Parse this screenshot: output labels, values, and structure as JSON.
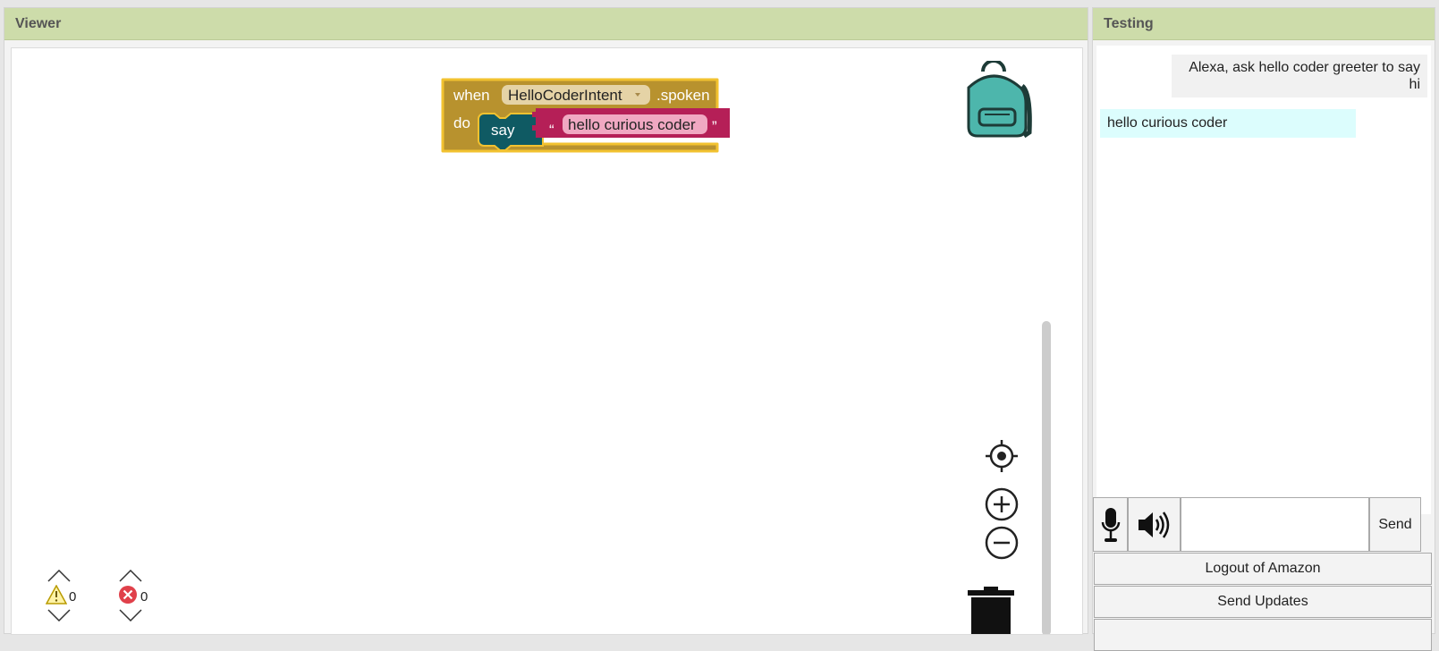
{
  "viewer": {
    "title": "Viewer",
    "block": {
      "when_label": "when",
      "intent_dropdown": "HelloCoderIntent",
      "spoken_label": ".spoken",
      "do_label": "do",
      "say_label": "say",
      "quote_open": "“",
      "string_value": "hello curious coder",
      "quote_close": "”"
    },
    "warnings": {
      "warning_count": "0",
      "error_count": "0"
    }
  },
  "testing": {
    "title": "Testing",
    "chat": {
      "user_message": "Alexa, ask hello coder greeter to say hi",
      "bot_message": "hello curious coder"
    },
    "controls": {
      "input_value": "",
      "send_label": "Send",
      "logout_label": "Logout of Amazon",
      "send_updates_label": "Send Updates"
    }
  },
  "colors": {
    "header_bg": "#cddcaa",
    "event_block": "#b8922e",
    "event_border": "#f2c230",
    "say_block": "#0f5a63",
    "text_block": "#b51f57",
    "text_field": "#f0a8c2",
    "bot_bubble": "#dcfdfd",
    "backpack": "#4db6ac"
  },
  "icons": [
    "backpack-icon",
    "recenter-icon",
    "zoom-in-icon",
    "zoom-out-icon",
    "trash-icon",
    "warning-icon",
    "error-icon",
    "microphone-icon",
    "speaker-icon"
  ]
}
